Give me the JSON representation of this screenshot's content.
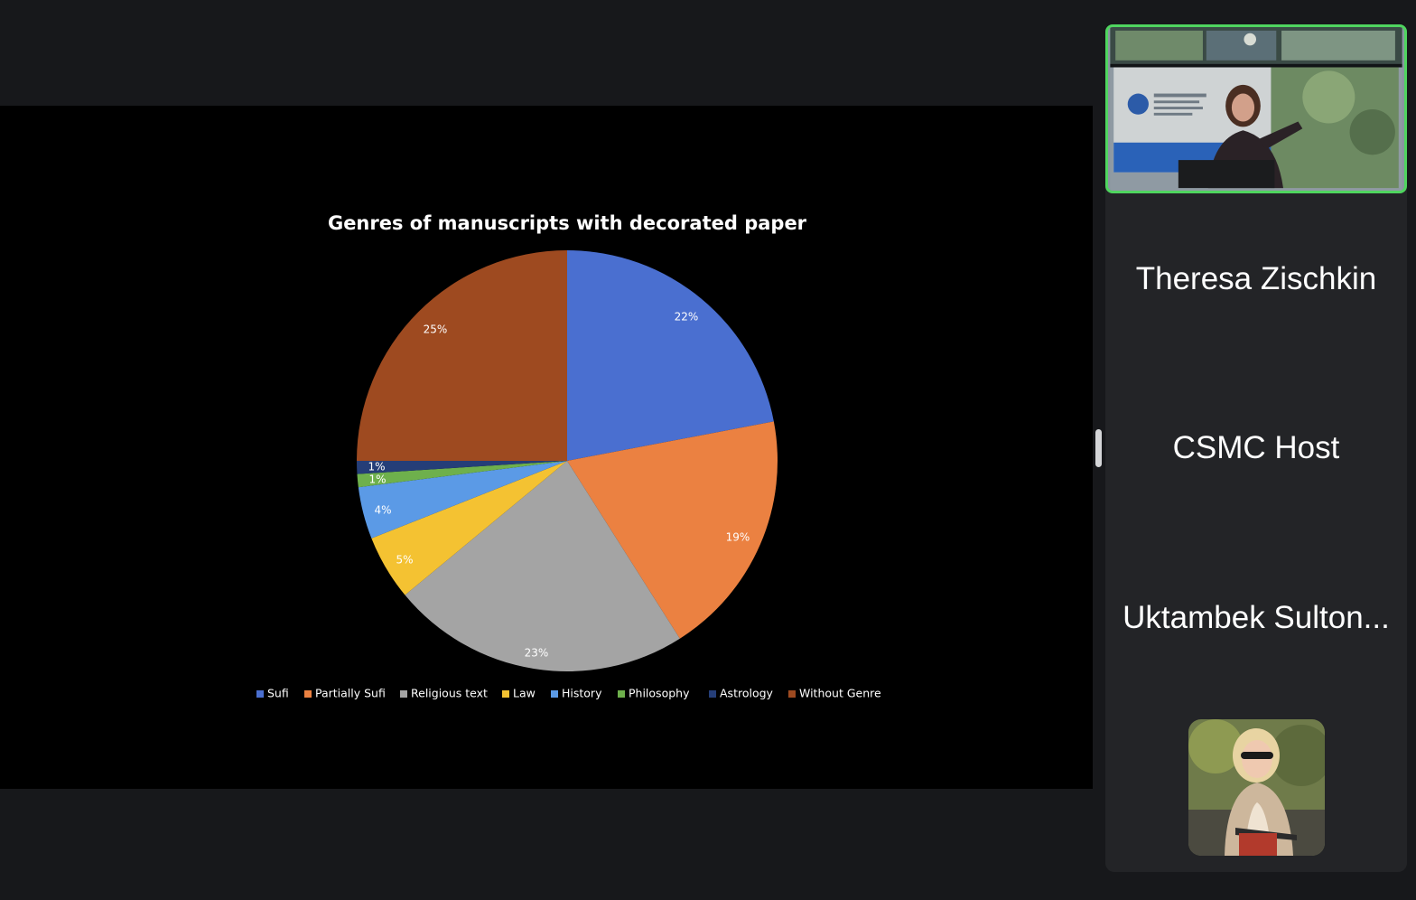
{
  "chart_data": {
    "type": "pie",
    "title": "Genres of manuscripts with decorated paper",
    "categories": [
      "Sufi",
      "Partially Sufi",
      "Religious text",
      "Law",
      "History",
      "Philosophy",
      "Astrology",
      "Without Genre"
    ],
    "values": [
      22,
      19,
      23,
      5,
      4,
      1,
      1,
      25
    ],
    "labels": [
      "22%",
      "19%",
      "23%",
      "5%",
      "4%",
      "1%",
      "1%",
      "25%"
    ],
    "colors": [
      "#4a6fd0",
      "#eb8141",
      "#a4a4a4",
      "#f4c232",
      "#5b9ae6",
      "#6eb04c",
      "#253e78",
      "#9e4a20"
    ],
    "start_angle_deg": 0,
    "direction": "clockwise",
    "legend": "bottom"
  },
  "participants": {
    "names": [
      "Theresa Zischkin",
      "CSMC Host",
      "Uktambek Sulton..."
    ]
  },
  "colors": {
    "active_speaker_border": "#4fd55f",
    "panel_background": "#232427",
    "share_background": "#000000",
    "app_background": "#17181b"
  },
  "icons": {
    "speaker_video": "active-speaker-video",
    "avatar": "participant-avatar-photo"
  }
}
